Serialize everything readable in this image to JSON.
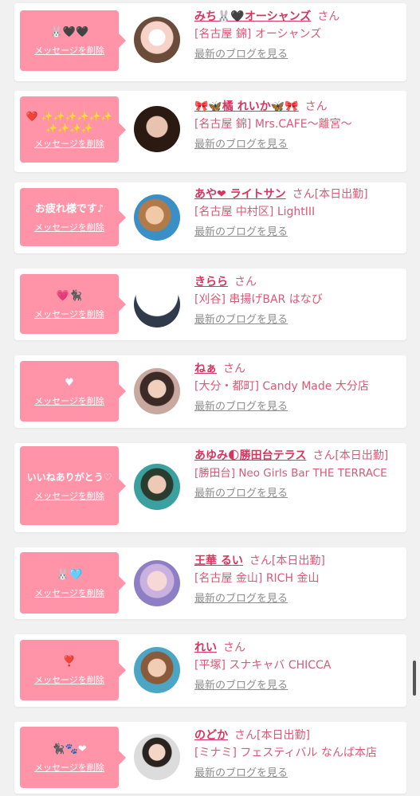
{
  "items": [
    {
      "message": "🐰🖤🖤",
      "delete_label": "メッセージを削除",
      "name": "みち🐰🖤オーシャンズ",
      "suffix": "さん",
      "shop": "[名古屋 錦] オーシャンズ",
      "blog_label": "最新のブログを見る"
    },
    {
      "message": "❤️ ✨✨✨✨✨✨ ✨✨✨✨",
      "delete_label": "メッセージを削除",
      "name": "🎀🦋橘 れいか🦋🎀",
      "suffix": "さん",
      "shop": "[名古屋 錦] Mrs.CAFE〜離宮〜",
      "blog_label": "最新のブログを見る"
    },
    {
      "message": "お疲れ様です♪",
      "delete_label": "メッセージを削除",
      "name": "あや❤ ライトサン",
      "suffix": "さん[本日出勤]",
      "shop": "[名古屋 中村区] LightIII",
      "blog_label": "最新のブログを見る"
    },
    {
      "message": "💗🐈‍⬛",
      "delete_label": "メッセージを削除",
      "name": "きらら",
      "suffix": "さん",
      "shop": "[刈谷] 串揚げBAR はなび",
      "blog_label": "最新のブログを見る"
    },
    {
      "message": "♥",
      "delete_label": "メッセージを削除",
      "name": "ねぁ",
      "suffix": "さん",
      "shop": "[大分・都町] Candy Made 大分店",
      "blog_label": "最新のブログを見る"
    },
    {
      "message": "いいねありがとう♡",
      "delete_label": "メッセージを削除",
      "name": "あゆみ🌓勝田台テラス",
      "suffix": "さん[本日出勤]",
      "shop": "[勝田台] Neo Girls Bar THE TERRACE",
      "blog_label": "最新のブログを見る"
    },
    {
      "message": "🐰🩵",
      "delete_label": "メッセージを削除",
      "name": "王華 るい",
      "suffix": "さん[本日出勤]",
      "shop": "[名古屋 金山] RICH 金山",
      "blog_label": "最新のブログを見る"
    },
    {
      "message": "❣️",
      "delete_label": "メッセージを削除",
      "name": "れい",
      "suffix": "さん",
      "shop": "[平塚] スナキャバ CHICCA",
      "blog_label": "最新のブログを見る"
    },
    {
      "message": "🐈‍⬛🐾❤",
      "delete_label": "メッセージを削除",
      "name": "のどか",
      "suffix": "さん[本日出勤]",
      "shop": "[ミナミ] フェスティバル なんば本店",
      "blog_label": "最新のブログを見る"
    }
  ],
  "colors": {
    "bubble": "#ff94a8",
    "name": "#d9345f",
    "text": "#d95a76",
    "link": "#8e8e8e",
    "background": "#f1f1f1"
  }
}
